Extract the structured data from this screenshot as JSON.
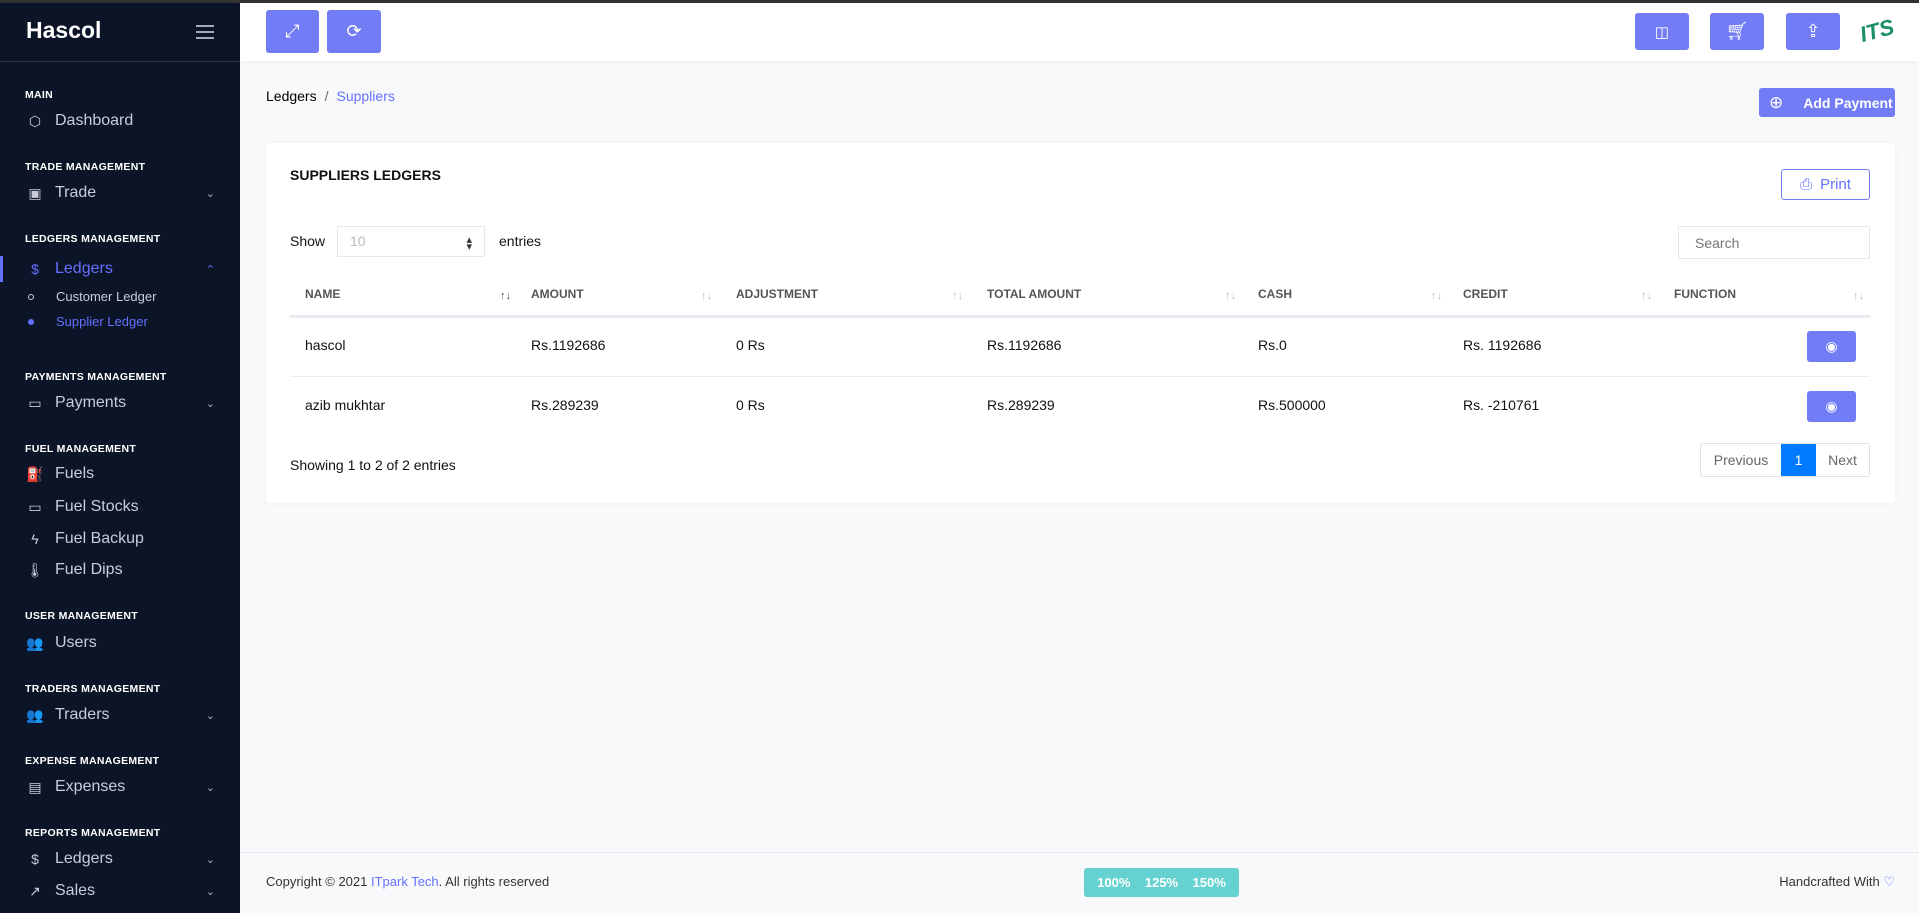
{
  "app": {
    "title": "Hascol"
  },
  "sidebar": {
    "sections": [
      "MAIN",
      "TRADE MANAGEMENT",
      "LEDGERS MANAGEMENT",
      "PAYMENTS MANAGEMENT",
      "FUEL MANAGEMENT",
      "USER MANAGEMENT",
      "TRADERS MANAGEMENT",
      "EXPENSE MANAGEMENT",
      "REPORTS MANAGEMENT"
    ],
    "items": [
      {
        "label": "Dashboard",
        "icon": "box-icon"
      },
      {
        "label": "Trade",
        "icon": "shopping-bag-icon"
      },
      {
        "label": "Ledgers",
        "icon": "dollar-icon",
        "active": true
      },
      {
        "label": "Payments",
        "icon": "credit-card-icon"
      },
      {
        "label": "Fuels",
        "icon": "fuel-pump-icon"
      },
      {
        "label": "Fuel Stocks",
        "icon": "battery-icon"
      },
      {
        "label": "Fuel Backup",
        "icon": "battery-charging-icon"
      },
      {
        "label": "Fuel Dips",
        "icon": "thermometer-icon"
      },
      {
        "label": "Users",
        "icon": "users-icon"
      },
      {
        "label": "Traders",
        "icon": "users-icon"
      },
      {
        "label": "Expenses",
        "icon": "receipt-icon"
      },
      {
        "label": "Ledgers",
        "icon": "dollar-icon"
      },
      {
        "label": "Sales",
        "icon": "trending-up-icon"
      }
    ],
    "subitems": [
      {
        "label": "Customer Ledger"
      },
      {
        "label": "Supplier Ledger",
        "active": true
      }
    ]
  },
  "breadcrumb": {
    "parent": "Ledgers",
    "separator": "/",
    "current": "Suppliers"
  },
  "actions": {
    "add_payment": "Add Payment"
  },
  "card": {
    "title": "SUPPLIERS LEDGERS",
    "print": "Print",
    "show": "Show",
    "entries_value": "10",
    "entries": "entries",
    "search_placeholder": "Search",
    "columns": [
      "NAME",
      "AMOUNT",
      "ADJUSTMENT",
      "TOTAL AMOUNT",
      "CASH",
      "CREDIT",
      "FUNCTION"
    ],
    "rows": [
      [
        "hascol",
        "Rs.1192686",
        "0 Rs",
        "Rs.1192686",
        "Rs.0",
        "Rs. 1192686"
      ],
      [
        "azib mukhtar",
        "Rs.289239",
        "0 Rs",
        "Rs.289239",
        "Rs.500000",
        "Rs. -210761"
      ]
    ],
    "info": "Showing 1 to 2 of 2 entries",
    "pagination": {
      "previous": "Previous",
      "page": "1",
      "next": "Next"
    }
  },
  "footer": {
    "copyright_prefix": "Copyright © 2021 ",
    "company": "ITpark Tech",
    "copyright_suffix": ". All rights reserved",
    "zoom": [
      "100%",
      "125%",
      "150%"
    ],
    "handcrafted": "Handcrafted With"
  },
  "colors": {
    "accent": "#727cf5",
    "sidebar": "#0c1427",
    "page_active": "#007bff",
    "zoom_badge": "#66d1d1"
  }
}
